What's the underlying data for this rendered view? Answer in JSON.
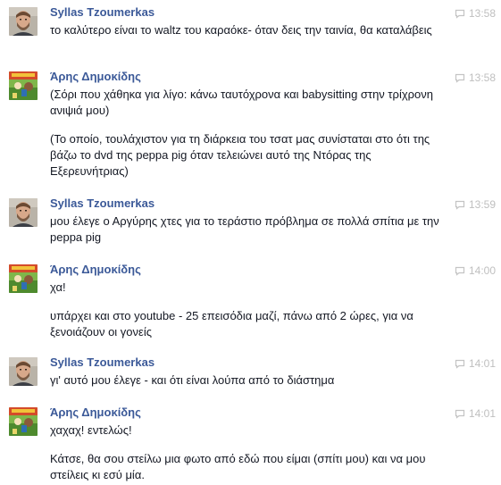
{
  "messages": [
    {
      "sender": "Syllas Tzoumerkas",
      "avatar": "man-beard-avatar",
      "time": "13:58",
      "lines": [
        "το καλύτερο είναι το waltz του καραόκε- όταν δεις την ταινία, θα καταλάβεις"
      ]
    },
    {
      "sender": "Άρης Δημοκίδης",
      "avatar": "cartoon-film-avatar",
      "time": "13:58",
      "lines": [
        "(Σόρι που χάθηκα για λίγο: κάνω ταυτόχρονα και babysitting στην τρίχρονη ανιψιά μου)",
        "(Το οποίο, τουλάχιστον για τη διάρκεια του τσατ μας συνίσταται στο ότι της βάζω το dvd της peppa pig όταν τελειώνει αυτό της Ντόρας της Εξερευνήτριας)"
      ]
    },
    {
      "sender": "Syllas Tzoumerkas",
      "avatar": "man-beard-avatar",
      "time": "13:59",
      "lines": [
        "μου έλεγε ο Αργύρης χτες για το τεράστιο πρόβλημα σε πολλά σπίτια με την peppa pig"
      ]
    },
    {
      "sender": "Άρης Δημοκίδης",
      "avatar": "cartoon-film-avatar",
      "time": "14:00",
      "lines": [
        "χα!",
        "υπάρχει και στο youtube - 25 επεισόδια μαζί, πάνω από 2 ώρες, για να ξενοιάζουν οι γονείς"
      ]
    },
    {
      "sender": "Syllas Tzoumerkas",
      "avatar": "man-beard-avatar",
      "time": "14:01",
      "lines": [
        "γι' αυτό μου έλεγε - και ότι είναι λούπα από το διάστημα"
      ]
    },
    {
      "sender": "Άρης Δημοκίδης",
      "avatar": "cartoon-film-avatar",
      "time": "14:01",
      "lines": [
        "χαχαχ! εντελώς!",
        "Κάτσε, θα σου στείλω μια φωτο από εδώ που είμαι (σπίτι μου) και να μου στείλεις κι εσύ μία."
      ]
    }
  ]
}
